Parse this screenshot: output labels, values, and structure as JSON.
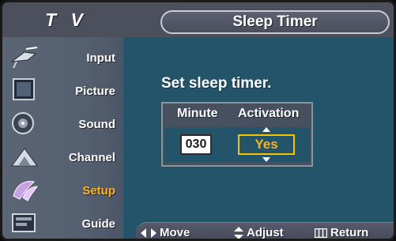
{
  "header": {
    "section": "T V",
    "title": "Sleep Timer"
  },
  "sidebar": {
    "items": [
      {
        "label": "Input",
        "icon": "input-icon",
        "active": false
      },
      {
        "label": "Picture",
        "icon": "picture-icon",
        "active": false
      },
      {
        "label": "Sound",
        "icon": "sound-icon",
        "active": false
      },
      {
        "label": "Channel",
        "icon": "channel-icon",
        "active": false
      },
      {
        "label": "Setup",
        "icon": "setup-icon",
        "active": true
      },
      {
        "label": "Guide",
        "icon": "guide-icon",
        "active": false
      }
    ],
    "active_color": "#ffb21a"
  },
  "main": {
    "prompt": "Set sleep timer.",
    "minute_header": "Minute",
    "activation_header": "Activation",
    "minute_value": "030",
    "activation_value": "Yes"
  },
  "footer": {
    "move": "Move",
    "adjust": "Adjust",
    "return": "Return"
  },
  "colors": {
    "background": "#23546a",
    "header": "#4c4f5c",
    "highlight": "#f2c500"
  }
}
